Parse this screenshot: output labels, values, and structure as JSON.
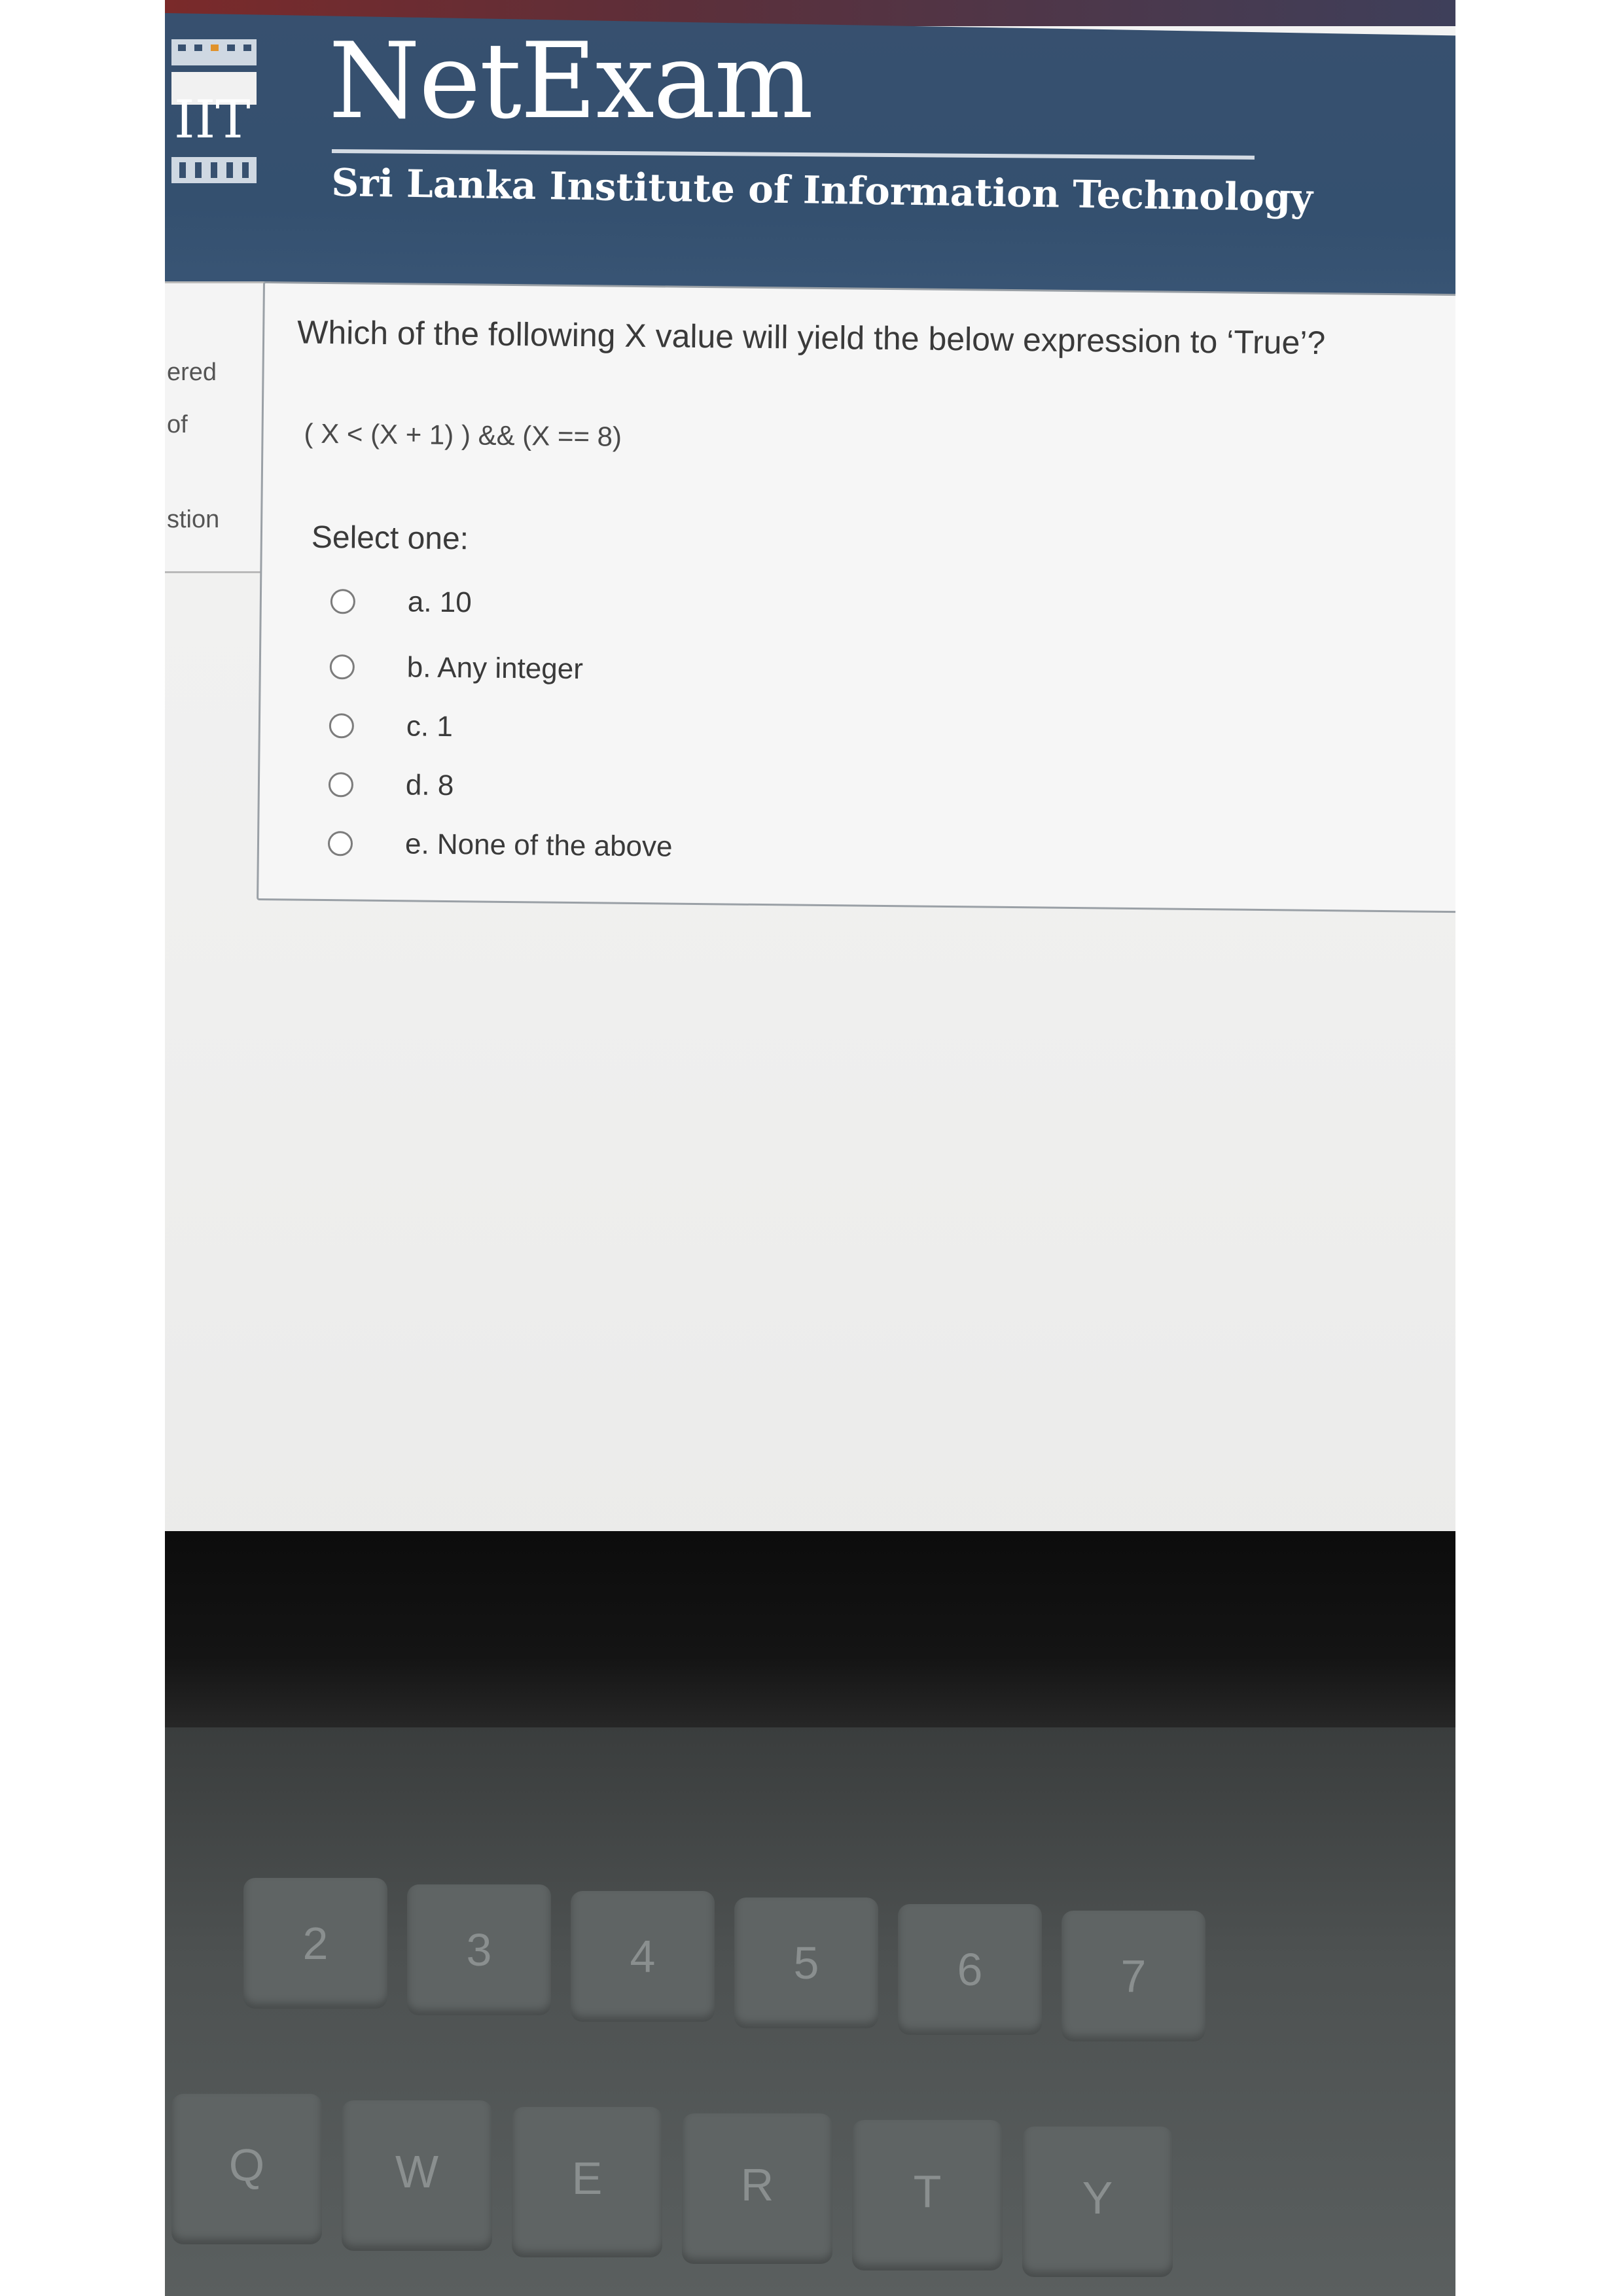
{
  "header": {
    "logo_text": "IIT",
    "brand": "NetExam",
    "institute": "Sri Lanka Institute of Information Technology",
    "colors": {
      "header_bg": "#34506f",
      "accent": "#e0922b"
    }
  },
  "info_panel": {
    "lines": [
      "ered",
      "of",
      "stion"
    ]
  },
  "question": {
    "text": "Which of the following X value will yield the below expression to ‘True’?",
    "expression": "( X < (X + 1) ) && (X == 8)",
    "select_label": "Select one:",
    "options": [
      {
        "label": "a. 10",
        "selected": false
      },
      {
        "label": "b. Any integer",
        "selected": false
      },
      {
        "label": "c. 1",
        "selected": false
      },
      {
        "label": "d. 8",
        "selected": false
      },
      {
        "label": "e. None of the above",
        "selected": false
      }
    ]
  },
  "keyboard": {
    "number_row": [
      "2",
      "3",
      "4",
      "5",
      "6",
      "7"
    ],
    "letter_row": [
      "Q",
      "W",
      "E",
      "R",
      "T",
      "Y"
    ]
  }
}
